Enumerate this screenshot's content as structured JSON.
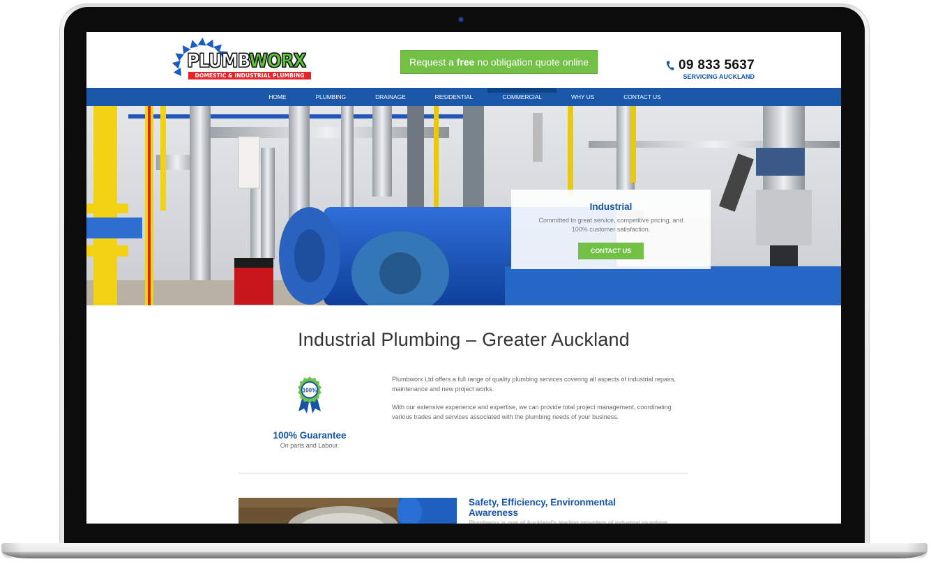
{
  "device": {
    "type": "laptop-mockup"
  },
  "header": {
    "logo": {
      "brand_part1": "PLUMB",
      "brand_part2": "WORX",
      "tagline": "DOMESTIC & INDUSTRIAL PLUMBING",
      "colors": {
        "arc": "#1a5dc0",
        "worx": "#5fc43c",
        "tagline_bg": "#e8242b"
      }
    },
    "quote_button": {
      "prefix": "Request a",
      "emphasis": "free",
      "suffix": "no obligation quote online",
      "color": "#72c045"
    },
    "phone": {
      "icon": "phone-icon",
      "number": "09 833 5637",
      "subtitle": "SERVICING AUCKLAND"
    }
  },
  "nav": {
    "color": "#1b57a8",
    "items": [
      {
        "label": "HOME",
        "active": false
      },
      {
        "label": "PLUMBING",
        "active": false
      },
      {
        "label": "DRAINAGE",
        "active": false
      },
      {
        "label": "RESIDENTIAL",
        "active": false
      },
      {
        "label": "COMMERCIAL",
        "active": true
      },
      {
        "label": "WHY US",
        "active": false
      },
      {
        "label": "CONTACT US",
        "active": false
      }
    ]
  },
  "hero": {
    "image": "industrial plant room with blue boilers and yellow gas pipes",
    "card": {
      "title": "Industrial",
      "text": "Committed to great service, competitive pricing, and 100% customer satisfaction.",
      "button": "CONTACT US"
    }
  },
  "main": {
    "title": "Industrial Plumbing – Greater Auckland",
    "guarantee": {
      "icon": "award-ribbon-icon",
      "badge_text": "100%",
      "title": "100% Guarantee",
      "subtitle": "On parts and Labour."
    },
    "intro_paragraphs": [
      "Plumbworx Ltd offers a full range of quality plumbing services covering all aspects of industrial repairs, maintenance and new project works.",
      "With our extensive experience and expertise, we can provide total project management, coordinating various trades and services associated with the plumbing needs of your business."
    ],
    "feature": {
      "image": "pipe fitting photo",
      "title": "Safety, Efficiency, Environmental Awareness",
      "text_truncated": "Plumbworx is one of Auckland's leading providers of industrial plumbing"
    }
  },
  "colors": {
    "primary_blue": "#1654a8",
    "accent_green": "#72c045",
    "body_text": "#666666"
  }
}
